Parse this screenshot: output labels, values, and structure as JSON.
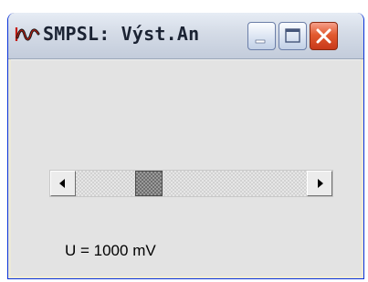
{
  "window": {
    "title": "SMPSL: Výst.An",
    "icon": "waveform-app-icon",
    "controls": {
      "minimize_icon": "minimize-icon",
      "maximize_icon": "maximize-icon",
      "close_icon": "close-icon"
    }
  },
  "slider": {
    "position_fraction": 0.29,
    "left_arrow_icon": "arrow-left-icon",
    "right_arrow_icon": "arrow-right-icon"
  },
  "readout": {
    "text": "U = 1000 mV"
  },
  "colors": {
    "client_background": "#e3e3e3",
    "close_button": "#d9482a",
    "titlebar": "#d4dbe6"
  }
}
